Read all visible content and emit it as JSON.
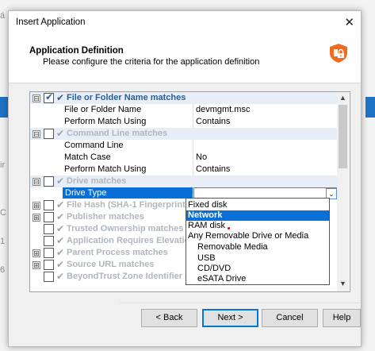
{
  "dialog": {
    "title": "Insert Application",
    "close_glyph": "✕",
    "header_title": "Application Definition",
    "header_subtitle": "Please configure the criteria for the application definition",
    "logo_icon": "beyondtrust-shield-lock-icon",
    "accent_color": "#f26b21"
  },
  "background": {
    "left_chars": [
      "á",
      "ir",
      "C",
      "1",
      "6"
    ]
  },
  "tree": {
    "groups": [
      {
        "name": "file-or-folder-name-matches",
        "expand": "⊟",
        "checked": true,
        "label": "File or Folder Name matches"
      },
      {
        "name": "command-line-matches",
        "expand": "⊟",
        "checked": false,
        "label": "Command Line matches"
      },
      {
        "name": "drive-matches",
        "expand": "⊟",
        "checked": false,
        "label": "Drive matches"
      },
      {
        "name": "file-hash-matches",
        "expand": "⊞",
        "checked": false,
        "label": "File Hash (SHA-1 Fingerprint) matches"
      },
      {
        "name": "publisher-matches",
        "expand": "⊞",
        "checked": false,
        "label": "Publisher matches"
      },
      {
        "name": "trusted-ownership-matches",
        "expand": "",
        "checked": false,
        "label": "Trusted Ownership matches"
      },
      {
        "name": "application-requires-elevation",
        "expand": "",
        "checked": false,
        "label": "Application Requires Elevation"
      },
      {
        "name": "parent-process-matches",
        "expand": "⊞",
        "checked": false,
        "label": "Parent Process matches"
      },
      {
        "name": "source-url-matches",
        "expand": "⊞",
        "checked": false,
        "label": "Source URL matches"
      },
      {
        "name": "beyondtrust-zone-identifier",
        "expand": "",
        "checked": false,
        "label": "BeyondTrust Zone Identifier e"
      }
    ],
    "props": [
      {
        "name": "File or Folder Name",
        "value": "devmgmt.msc"
      },
      {
        "name": "Perform Match Using",
        "value": "Contains"
      },
      {
        "name": "Command Line",
        "value": ""
      },
      {
        "name": "Match Case",
        "value": "No"
      },
      {
        "name": "Perform Match Using",
        "value": "Contains"
      }
    ],
    "selected_prop": "Drive Type",
    "selected_value": "",
    "check_glyph": "✔"
  },
  "dropdown": {
    "options": [
      {
        "label": "Fixed disk",
        "indent": false,
        "highlighted": false
      },
      {
        "label": "Network",
        "indent": false,
        "highlighted": true
      },
      {
        "label": "RAM disk",
        "indent": false,
        "highlighted": false
      },
      {
        "label": "Any Removable Drive or Media",
        "indent": false,
        "highlighted": false
      },
      {
        "label": "Removable Media",
        "indent": true,
        "highlighted": false
      },
      {
        "label": "USB",
        "indent": true,
        "highlighted": false
      },
      {
        "label": "CD/DVD",
        "indent": true,
        "highlighted": false
      },
      {
        "label": "eSATA Drive",
        "indent": true,
        "highlighted": false
      }
    ]
  },
  "buttons": {
    "back": "< Back",
    "next": "Next >",
    "cancel": "Cancel",
    "help": "Help"
  }
}
